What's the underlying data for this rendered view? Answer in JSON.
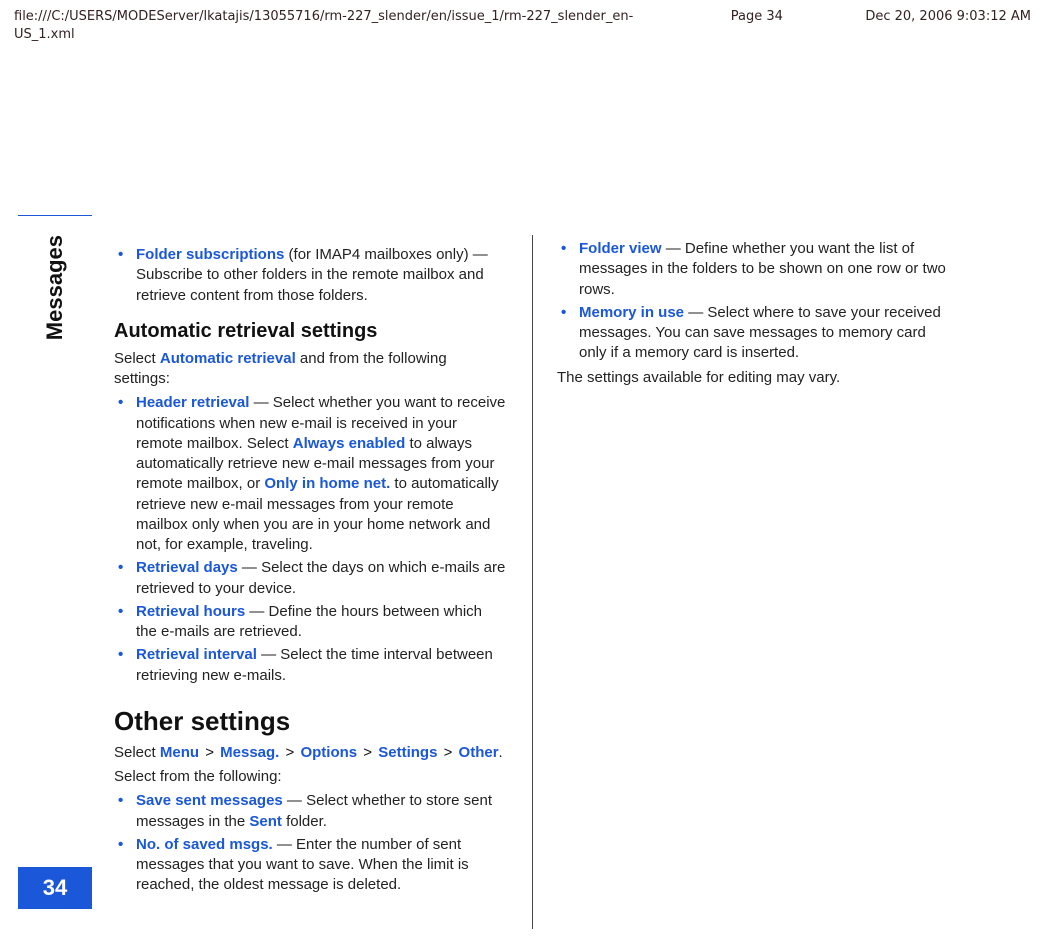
{
  "header": {
    "path": "file:///C:/USERS/MODEServer/lkatajis/13055716/rm-227_slender/en/issue_1/rm-227_slender_en-US_1.xml",
    "page": "Page 34",
    "datetime": "Dec 20, 2006 9:03:12 AM"
  },
  "sidebar": {
    "section_label": "Messages",
    "page_number": "34"
  },
  "left": {
    "folder_sub_item": {
      "term": "Folder subscriptions",
      "rest": " (for IMAP4 mailboxes only) — Subscribe to other folders in the remote mailbox and retrieve content from those folders."
    },
    "auto_heading": "Automatic retrieval settings",
    "auto_intro_pre": "Select ",
    "auto_intro_term": "Automatic retrieval",
    "auto_intro_post": " and from the following settings:",
    "auto_items": {
      "header_retrieval": {
        "term": "Header retrieval",
        "t1": " — Select whether you want to receive notifications when new e-mail is received in your remote mailbox. Select ",
        "term2": "Always enabled",
        "t2": " to always automatically retrieve new e-mail messages from your remote mailbox, or ",
        "term3": "Only in home net.",
        "t3": " to automatically retrieve new e-mail messages from your remote mailbox only when you are in your home network and not, for example, traveling."
      },
      "retrieval_days": {
        "term": "Retrieval days",
        "rest": " — Select the days on which e-mails are retrieved to your device."
      },
      "retrieval_hours": {
        "term": "Retrieval hours",
        "rest": " — Define the hours between which the e-mails are retrieved."
      },
      "retrieval_interval": {
        "term": "Retrieval interval",
        "rest": " — Select the time interval between retrieving new e-mails."
      }
    },
    "other_heading": "Other settings",
    "other_path": {
      "pre": "Select ",
      "p1": "Menu",
      "gt1": " > ",
      "p2": "Messag.",
      "gt2": " > ",
      "p3": "Options",
      "gt3": " > ",
      "p4": "Settings",
      "gt4": " > ",
      "p5": "Other",
      "post": "."
    },
    "other_select": "Select from the following:",
    "other_items": {
      "save_sent": {
        "term": "Save sent messages",
        "t1": " — Select whether to store sent messages in the ",
        "term2": "Sent",
        "t2": " folder."
      },
      "no_saved": {
        "term": "No. of saved msgs.",
        "rest": " — Enter the number of sent messages that you want to save. When the limit is reached, the oldest message is deleted."
      }
    }
  },
  "right": {
    "items": {
      "folder_view": {
        "term": "Folder view",
        "rest": " — Define whether you want the list of messages in the folders to be shown on one row or two rows."
      },
      "memory": {
        "term": "Memory in use",
        "rest": " — Select where to save your received messages. You can save messages to memory card only if a memory card is inserted."
      }
    },
    "closing": "The settings available for editing may vary."
  }
}
